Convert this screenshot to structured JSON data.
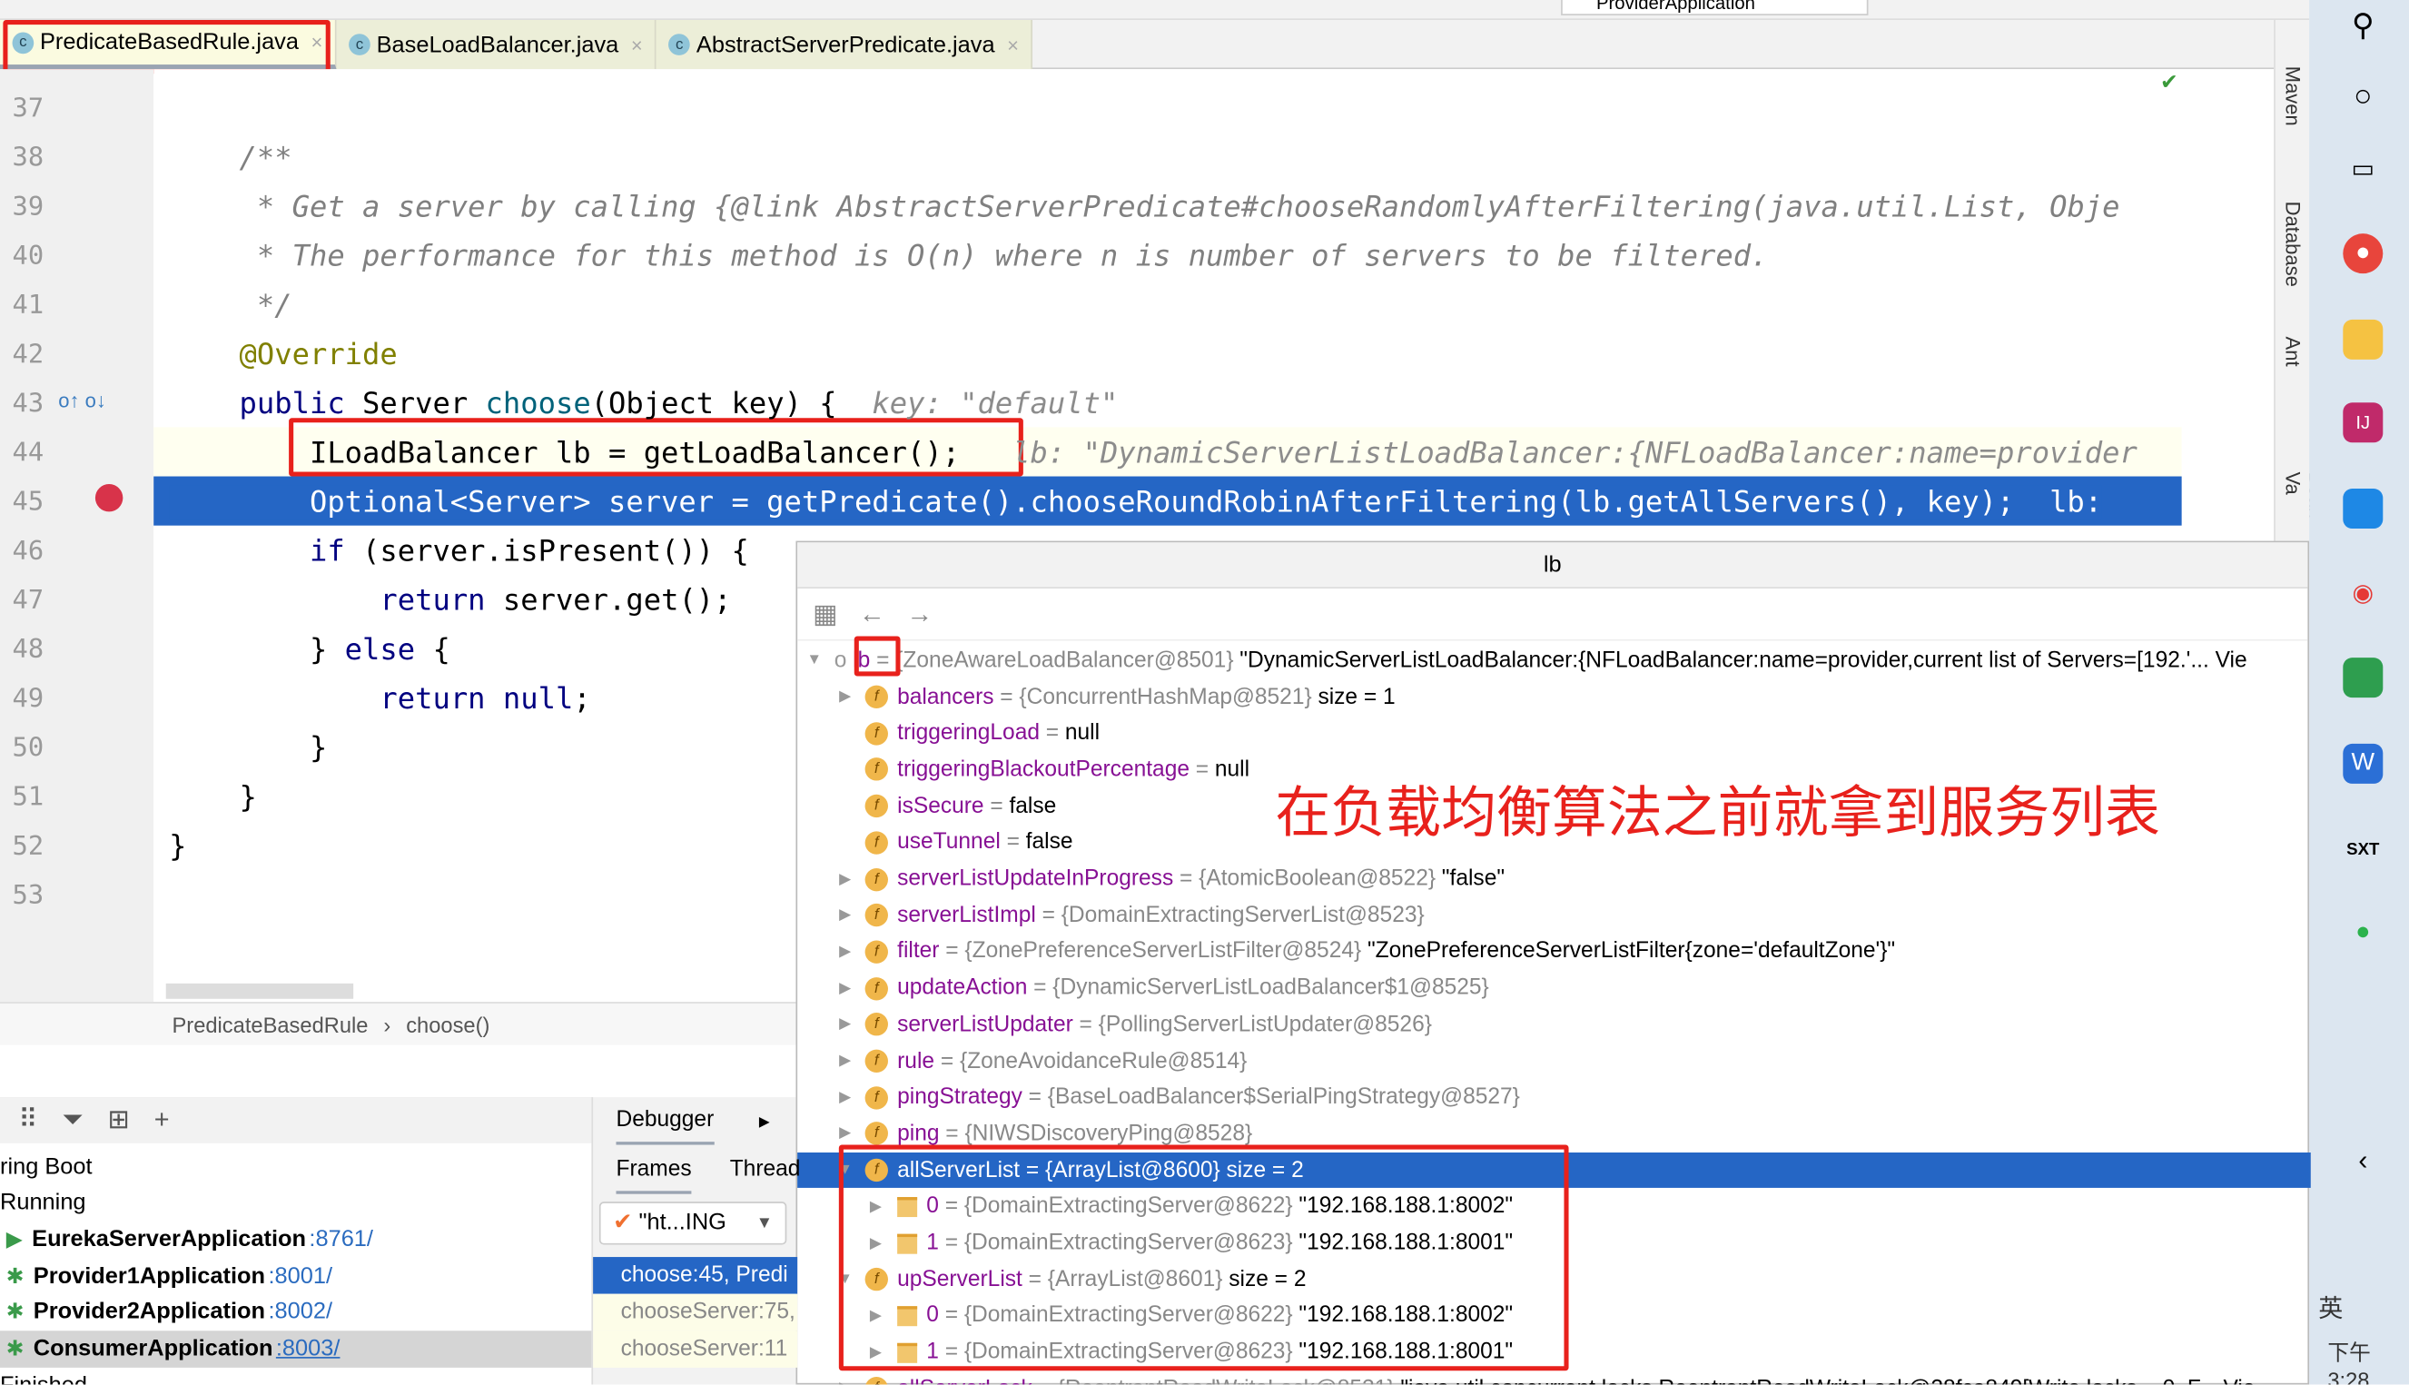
{
  "tabs": [
    {
      "label": "PredicateBasedRule.java",
      "active": true
    },
    {
      "label": "BaseLoadBalancer.java"
    },
    {
      "label": "AbstractServerPredicate.java"
    }
  ],
  "run_config": "ProviderApplication",
  "code_lines": [
    {
      "n": "37",
      "segs": []
    },
    {
      "n": "38",
      "segs": [
        {
          "t": "    /**",
          "c": "cm"
        }
      ]
    },
    {
      "n": "39",
      "segs": [
        {
          "t": "     * Get a server by calling {",
          "c": "cm"
        },
        {
          "t": "@link",
          "c": "cm"
        },
        {
          "t": " AbstractServerPredicate#chooseRandomlyAfterFiltering(java.util.List, Obje",
          "c": "cm"
        }
      ]
    },
    {
      "n": "40",
      "segs": [
        {
          "t": "     * The performance for this method is O(n) where n is number of servers to be filtered.",
          "c": "cm"
        }
      ]
    },
    {
      "n": "41",
      "segs": [
        {
          "t": "     */",
          "c": "cm"
        }
      ]
    },
    {
      "n": "42",
      "segs": [
        {
          "t": "    @Override",
          "c": "ann"
        }
      ]
    },
    {
      "n": "43",
      "segs": [
        {
          "t": "    public ",
          "c": "kw"
        },
        {
          "t": "Server ",
          "c": ""
        },
        {
          "t": "choose",
          "c": "mt"
        },
        {
          "t": "(Object key) {  ",
          "c": ""
        },
        {
          "t": "key: \"default\"",
          "c": "hint"
        }
      ]
    },
    {
      "n": "44",
      "segs": [
        {
          "t": "        ILoadBalancer lb = getLoadBalancer();   ",
          "c": ""
        },
        {
          "t": "lb: \"DynamicServerListLoadBalancer:{NFLoadBalancer:name=provider",
          "c": "hint"
        }
      ]
    },
    {
      "n": "45",
      "segs": [
        {
          "t": "        Optional<Server> server = getPredicate().chooseRoundRobinAfterFiltering(lb.getAllServers(), key);  lb:",
          "c": "sel"
        }
      ]
    },
    {
      "n": "46",
      "segs": [
        {
          "t": "        ",
          "c": ""
        },
        {
          "t": "if ",
          "c": "kw"
        },
        {
          "t": "(server.isPresent()) {",
          "c": ""
        }
      ]
    },
    {
      "n": "47",
      "segs": [
        {
          "t": "            ",
          "c": ""
        },
        {
          "t": "return ",
          "c": "kw"
        },
        {
          "t": "server.get();",
          "c": ""
        }
      ]
    },
    {
      "n": "48",
      "segs": [
        {
          "t": "        } ",
          "c": ""
        },
        {
          "t": "else ",
          "c": "kw"
        },
        {
          "t": "{",
          "c": ""
        }
      ]
    },
    {
      "n": "49",
      "segs": [
        {
          "t": "            ",
          "c": ""
        },
        {
          "t": "return null",
          "c": "kw"
        },
        {
          "t": ";",
          "c": ""
        }
      ]
    },
    {
      "n": "50",
      "segs": [
        {
          "t": "        }",
          "c": ""
        }
      ]
    },
    {
      "n": "51",
      "segs": [
        {
          "t": "    }",
          "c": ""
        }
      ]
    },
    {
      "n": "52",
      "segs": [
        {
          "t": "}",
          "c": ""
        }
      ]
    },
    {
      "n": "53",
      "segs": []
    }
  ],
  "breadcrumb": {
    "class": "PredicateBasedRule",
    "sep": "›",
    "method": "choose()"
  },
  "right_tools": [
    "Maven",
    "Database",
    "Ant",
    "Bean Va"
  ],
  "popup": {
    "title": "lb",
    "rows": [
      {
        "d": 0,
        "e": "▼",
        "i": "obj",
        "n": "lb",
        "v": "= {ZoneAwareLoadBalancer@8501}",
        "q": "\"DynamicServerListLoadBalancer:{NFLoadBalancer:name=provider,current list of Servers=[192.'... Vie"
      },
      {
        "d": 1,
        "e": "▶",
        "i": "f",
        "n": "balancers",
        "v": "= {ConcurrentHashMap@8521}",
        "q": "size = 1"
      },
      {
        "d": 1,
        "e": "",
        "i": "f",
        "n": "triggeringLoad",
        "v": "=",
        "q": "null"
      },
      {
        "d": 1,
        "e": "",
        "i": "f",
        "n": "triggeringBlackoutPercentage",
        "v": "=",
        "q": "null"
      },
      {
        "d": 1,
        "e": "",
        "i": "f",
        "n": "isSecure",
        "v": "=",
        "q": "false"
      },
      {
        "d": 1,
        "e": "",
        "i": "f",
        "n": "useTunnel",
        "v": "=",
        "q": "false"
      },
      {
        "d": 1,
        "e": "▶",
        "i": "f",
        "n": "serverListUpdateInProgress",
        "v": "= {AtomicBoolean@8522}",
        "q": "\"false\""
      },
      {
        "d": 1,
        "e": "▶",
        "i": "f",
        "n": "serverListImpl",
        "v": "= {DomainExtractingServerList@8523}",
        "q": ""
      },
      {
        "d": 1,
        "e": "▶",
        "i": "f",
        "n": "filter",
        "v": "= {ZonePreferenceServerListFilter@8524}",
        "q": "\"ZonePreferenceServerListFilter{zone='defaultZone'}\""
      },
      {
        "d": 1,
        "e": "▶",
        "i": "f",
        "n": "updateAction",
        "v": "= {DynamicServerListLoadBalancer$1@8525}",
        "q": ""
      },
      {
        "d": 1,
        "e": "▶",
        "i": "f",
        "n": "serverListUpdater",
        "v": "= {PollingServerListUpdater@8526}",
        "q": ""
      },
      {
        "d": 1,
        "e": "▶",
        "i": "f",
        "n": "rule",
        "v": "= {ZoneAvoidanceRule@8514}",
        "q": ""
      },
      {
        "d": 1,
        "e": "▶",
        "i": "f",
        "n": "pingStrategy",
        "v": "= {BaseLoadBalancer$SerialPingStrategy@8527}",
        "q": ""
      },
      {
        "d": 1,
        "e": "▶",
        "i": "f",
        "n": "ping",
        "v": "= {NIWSDiscoveryPing@8528}",
        "q": ""
      },
      {
        "d": 1,
        "e": "▼",
        "i": "f",
        "n": "allServerList",
        "v": "= {ArrayList@8600}",
        "q": "size = 2",
        "hl": true
      },
      {
        "d": 2,
        "e": "▶",
        "i": "a",
        "n": "0",
        "v": "= {DomainExtractingServer@8622}",
        "q": "\"192.168.188.1:8002\""
      },
      {
        "d": 2,
        "e": "▶",
        "i": "a",
        "n": "1",
        "v": "= {DomainExtractingServer@8623}",
        "q": "\"192.168.188.1:8001\""
      },
      {
        "d": 1,
        "e": "▼",
        "i": "f",
        "n": "upServerList",
        "v": "= {ArrayList@8601}",
        "q": "size = 2"
      },
      {
        "d": 2,
        "e": "▶",
        "i": "a",
        "n": "0",
        "v": "= {DomainExtractingServer@8622}",
        "q": "\"192.168.188.1:8002\""
      },
      {
        "d": 2,
        "e": "▶",
        "i": "a",
        "n": "1",
        "v": "= {DomainExtractingServer@8623}",
        "q": "\"192.168.188.1:8001\""
      },
      {
        "d": 1,
        "e": "▶",
        "i": "f",
        "n": "allServerLock",
        "v": "= {ReentrantReadWriteLock@8531}",
        "q": "\"java.util.concurrent.locks.ReentrantReadWriteLock@28fca849[Write locks = 0, F... Vie"
      }
    ]
  },
  "annotation": "在负载均衡算法之前就拿到服务列表",
  "services": {
    "rows": [
      {
        "label": "ring Boot",
        "port": "",
        "kind": "group"
      },
      {
        "label": "Running",
        "port": "",
        "kind": "group"
      },
      {
        "label": "EurekaServerApplication",
        "port": ":8761/",
        "kind": "run"
      },
      {
        "label": "Provider1Application",
        "port": ":8001/",
        "kind": "debug"
      },
      {
        "label": "Provider2Application",
        "port": ":8002/",
        "kind": "debug"
      },
      {
        "label": "ConsumerApplication",
        "port": ":8003/",
        "kind": "debug",
        "selected": true
      },
      {
        "label": "Finished",
        "port": "",
        "kind": "group"
      }
    ]
  },
  "debugger": {
    "tab": "Debugger",
    "subtabs": [
      "Frames",
      "Thread"
    ],
    "thread": "\"ht...ING",
    "frames": [
      "choose:45, Predi",
      "chooseServer:75,",
      "chooseServer:11"
    ]
  },
  "clock": "下午 3:28",
  "ime": "英"
}
